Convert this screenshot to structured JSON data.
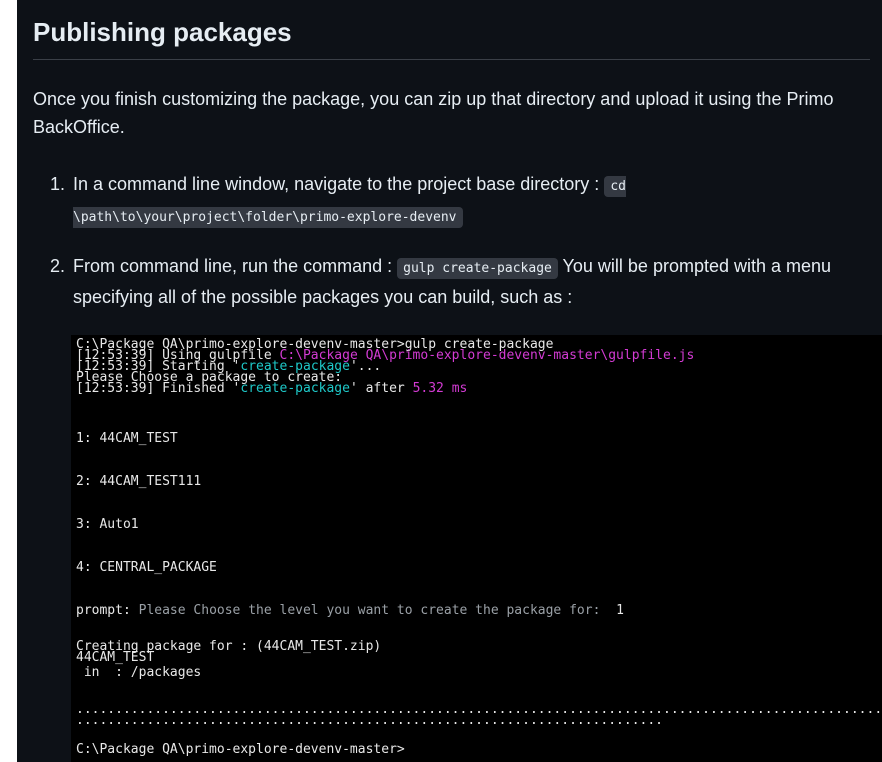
{
  "heading": "Publishing packages",
  "intro": "Once you finish customizing the package, you can zip up that directory and upload it using the Primo BackOffice.",
  "steps": [
    {
      "number": "1.",
      "text": "In a command line window, navigate to the project base directory :",
      "code": "cd \\path\\to\\your\\project\\folder\\primo-explore-devenv"
    },
    {
      "number": "2.",
      "text_before": "From command line, run the command :",
      "code": "gulp create-package",
      "text_after": "You will be prompted with a menu specifying all of the possible packages you can build, such as :"
    }
  ],
  "terminal": {
    "line1": "C:\\Package QA\\primo-explore-devenv-master>gulp create-package",
    "line2_prefix": "[12:53:39] Using gulpfile ",
    "line2_path": "C:\\Package QA\\primo-explore-devenv-master\\gulpfile.js",
    "line3_prefix": "[12:53:39] Starting '",
    "line3_task": "create-package",
    "line3_suffix": "'...",
    "line4": "Please Choose a package to create:",
    "line5_prefix": "[12:53:39] Finished '",
    "line5_task": "create-package",
    "line5_mid": "' after ",
    "line5_time": "5.32 ms",
    "options": [
      "1: 44CAM_TEST",
      "2: 44CAM_TEST111",
      "3: Auto1",
      "4: CENTRAL_PACKAGE"
    ],
    "prompt_label": "prompt:",
    "prompt_text": " Please Choose the level you want to create the package for:  ",
    "prompt_answer": "1",
    "creating1": "Creating package for : (44CAM_TEST.zip)",
    "creating2": "44CAM_TEST",
    "creating3": " in  : /packages",
    "dots1": ".......................................................................................................",
    "dots2": "...........................................................................",
    "final_prompt": "C:\\Package QA\\primo-explore-devenv-master>"
  },
  "colors": {
    "background": "#0d1117",
    "terminal_bg": "#000000",
    "cyan": "#1ec8c8",
    "magenta": "#d33bd3"
  }
}
